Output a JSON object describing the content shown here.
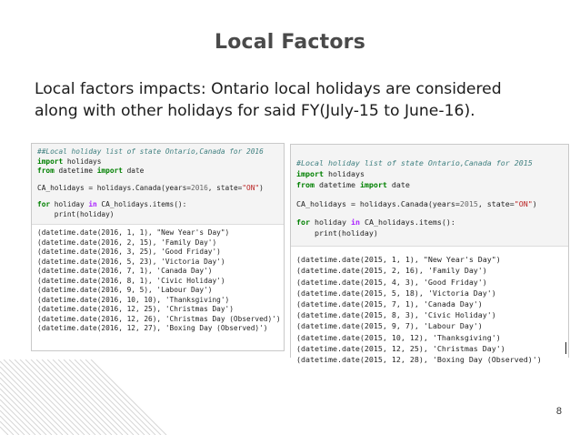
{
  "slide": {
    "title": "Local Factors",
    "body": "Local factors impacts: Ontario local holidays are considered\nalong with other holidays for said FY(July-15 to June-16).",
    "page_number": "8"
  },
  "left_panel": {
    "comment": "##Local holiday list of state Ontario,Canada for 2016",
    "import_kw": "import",
    "import_mod": " holidays",
    "from_kw": "from",
    "from_mod": " datetime ",
    "from_import_kw": "import",
    "from_name": " date",
    "assign_pre": "CA_holidays = holidays.Canada(years=",
    "assign_year": "2016",
    "assign_mid": ", state=",
    "assign_state": "\"ON\"",
    "assign_post": ")",
    "for_kw": "for",
    "for_mid": " holiday ",
    "in_kw": "in",
    "for_post": " CA_holidays.items():",
    "print_line": "    print(holiday)",
    "output": [
      "(datetime.date(2016, 1, 1), \"New Year's Day\")",
      "(datetime.date(2016, 2, 15), 'Family Day')",
      "(datetime.date(2016, 3, 25), 'Good Friday')",
      "(datetime.date(2016, 5, 23), 'Victoria Day')",
      "(datetime.date(2016, 7, 1), 'Canada Day')",
      "(datetime.date(2016, 8, 1), 'Civic Holiday')",
      "(datetime.date(2016, 9, 5), 'Labour Day')",
      "(datetime.date(2016, 10, 10), 'Thanksgiving')",
      "(datetime.date(2016, 12, 25), 'Christmas Day')",
      "(datetime.date(2016, 12, 26), 'Christmas Day (Observed)')",
      "(datetime.date(2016, 12, 27), 'Boxing Day (Observed)')"
    ]
  },
  "right_panel": {
    "comment": "#Local holiday list of state Ontario,Canada for 2015",
    "import_kw": "import",
    "import_mod": " holidays",
    "from_kw": "from",
    "from_mod": " datetime ",
    "from_import_kw": "import",
    "from_name": " date",
    "assign_pre": "CA_holidays = holidays.Canada(years=",
    "assign_year": "2015",
    "assign_mid": ", state=",
    "assign_state": "\"ON\"",
    "assign_post": ")",
    "for_kw": "for",
    "for_mid": " holiday ",
    "in_kw": "in",
    "for_post": " CA_holidays.items():",
    "print_line": "    print(holiday)",
    "output": [
      "(datetime.date(2015, 1, 1), \"New Year's Day\")",
      "(datetime.date(2015, 2, 16), 'Family Day')",
      "(datetime.date(2015, 4, 3), 'Good Friday')",
      "(datetime.date(2015, 5, 18), 'Victoria Day')",
      "(datetime.date(2015, 7, 1), 'Canada Day')",
      "(datetime.date(2015, 8, 3), 'Civic Holiday')",
      "(datetime.date(2015, 9, 7), 'Labour Day')",
      "(datetime.date(2015, 10, 12), 'Thanksgiving')",
      "(datetime.date(2015, 12, 25), 'Christmas Day')",
      "(datetime.date(2015, 12, 28), 'Boxing Day (Observed)')"
    ]
  },
  "colors": {
    "title": "#4a4a4a",
    "comment": "#408080",
    "keyword": "#008000",
    "string": "#ba2121",
    "cell_background": "#f4f4f4",
    "decoration": "#d6d6d6"
  },
  "icons": {
    "corner_decoration": "diagonal-lines-pattern"
  }
}
